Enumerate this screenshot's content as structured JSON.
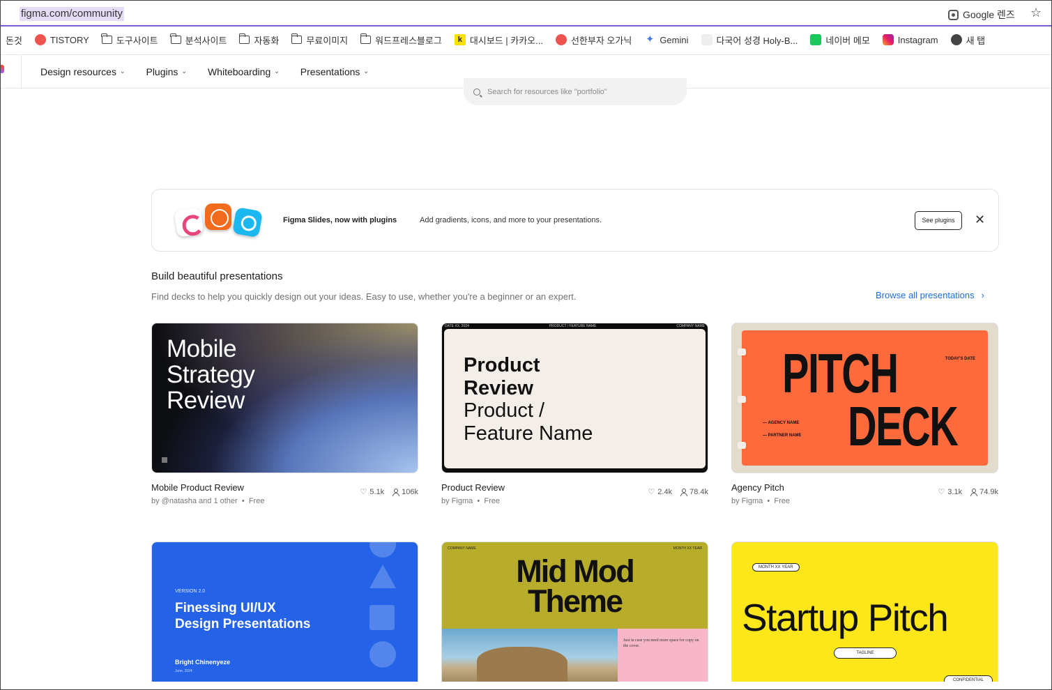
{
  "browser": {
    "url": "figma.com/community",
    "lens_label": "Google 렌즈",
    "star": "☆"
  },
  "bookmarks": [
    {
      "label": "돈것",
      "icon": "none"
    },
    {
      "label": "TISTORY",
      "icon": "tistory-icon"
    },
    {
      "label": "도구사이트",
      "icon": "folder-icon"
    },
    {
      "label": "분석사이트",
      "icon": "folder-icon"
    },
    {
      "label": "자동화",
      "icon": "folder-icon"
    },
    {
      "label": "무료이미지",
      "icon": "folder-icon"
    },
    {
      "label": "워드프레스블로그",
      "icon": "folder-icon"
    },
    {
      "label": "대시보드 | 카카오...",
      "icon": "kakao-icon"
    },
    {
      "label": "선한부자 오가닉",
      "icon": "tistory-icon"
    },
    {
      "label": "Gemini",
      "icon": "gemini-icon"
    },
    {
      "label": "다국어 성경 Holy-B...",
      "icon": "holy-icon"
    },
    {
      "label": "네이버 메모",
      "icon": "naver-memo-icon"
    },
    {
      "label": "Instagram",
      "icon": "instagram-icon"
    },
    {
      "label": "새 탭",
      "icon": "globe-icon"
    }
  ],
  "nav": {
    "items": [
      "Design resources",
      "Plugins",
      "Whiteboarding",
      "Presentations"
    ]
  },
  "search": {
    "placeholder": "Search for resources like \"portfolio\""
  },
  "banner": {
    "title": "Figma Slides, now with plugins",
    "description": "Add gradients, icons, and more to your presentations.",
    "button": "See plugins",
    "close": "✕"
  },
  "section": {
    "title": "Build beautiful presentations",
    "subtitle": "Find decks to help you quickly design out your ideas. Easy to use, whether you're a beginner or an expert.",
    "browse": "Browse all presentations",
    "browse_arrow": "›"
  },
  "cards": [
    {
      "title": "Mobile Product Review",
      "author": "by @natasha and 1 other",
      "price": "Free",
      "likes": "5.1k",
      "users": "106k",
      "thumb_text": [
        "Mobile",
        "Strategy",
        "Review"
      ]
    },
    {
      "title": "Product Review",
      "author": "by Figma",
      "price": "Free",
      "likes": "2.4k",
      "users": "78.4k",
      "thumb_top_left": "DATE XX. 2024",
      "thumb_top_mid": "PRODUCT / FEATURE NAME",
      "thumb_top_right": "COMPANY NAME",
      "thumb_bold": [
        "Product",
        "Review"
      ],
      "thumb_light": [
        "Product /",
        "Feature Name"
      ]
    },
    {
      "title": "Agency Pitch",
      "author": "by Figma",
      "price": "Free",
      "likes": "3.1k",
      "users": "74.9k",
      "thumb_big1": "PITCH",
      "thumb_big2": "DECK",
      "thumb_date": "TODAY'S DATE",
      "thumb_agency": "— AGENCY NAME",
      "thumb_partner": "— PARTNER NAME"
    },
    {
      "thumb_version": "VERSION 2.0",
      "thumb_title": [
        "Finessing UI/UX",
        "Design Presentations"
      ],
      "thumb_author": "Bright Chinenyeze",
      "thumb_date": "June, 2024"
    },
    {
      "thumb_top_left": "COMPANY NAME",
      "thumb_top_right": "MONTH XX YEAR",
      "thumb_title": [
        "Mid Mod",
        "Theme"
      ],
      "thumb_caption": "Just in case you need more space for copy on the cover."
    },
    {
      "thumb_month": "MONTH XX YEAR",
      "thumb_title": "Startup Pitch",
      "thumb_tagline": "TAGLINE",
      "thumb_conf": "CONFIDENTIAL"
    }
  ],
  "bullet": "•",
  "colors": {
    "accent_link": "#1c6cd9",
    "card_blue": "#2463e8",
    "card_orange": "#ff6a3d",
    "card_yellow": "#fde71a",
    "card_olive": "#b7ad2a"
  }
}
